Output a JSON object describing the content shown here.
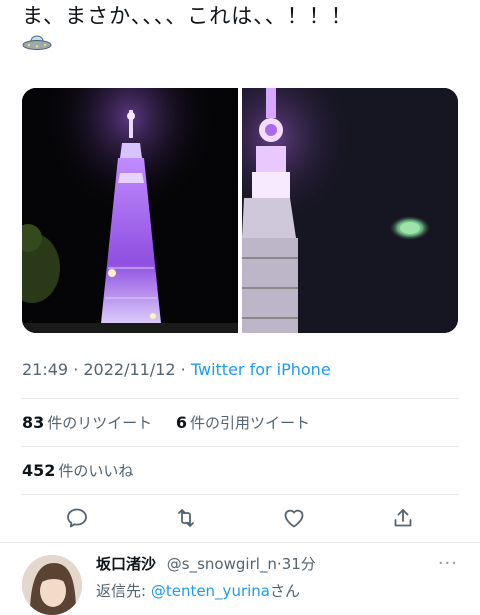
{
  "tweet": {
    "text": "ま、まさか、、、、これは、、！！！"
  },
  "meta": {
    "time": "21:49",
    "dot1": " · ",
    "date": "2022/11/12",
    "dot2": " · ",
    "source": "Twitter for iPhone"
  },
  "stats": {
    "retweets_count": "83",
    "retweets_label": "件のリツイート",
    "quotes_count": "6",
    "quotes_label": "件の引用ツイート",
    "likes_count": "452",
    "likes_label": "件のいいね"
  },
  "actions": [
    {
      "icon": "reply-icon"
    },
    {
      "icon": "retweet-icon"
    },
    {
      "icon": "like-icon"
    },
    {
      "icon": "share-icon"
    }
  ],
  "reply": {
    "name": "坂口渚沙",
    "handle": "@s_snowgirl_n",
    "dot": "·",
    "age": "31分",
    "reply_to_prefix": "返信先: ",
    "reply_to_handle": "@tenten_yurina",
    "reply_to_suffix": "さん",
    "more": "···"
  },
  "colors": {
    "accent": "#1d9bf0",
    "secondary_text": "#536471",
    "divider": "#e7e9ea",
    "tower_purple": "#9b4dff"
  }
}
